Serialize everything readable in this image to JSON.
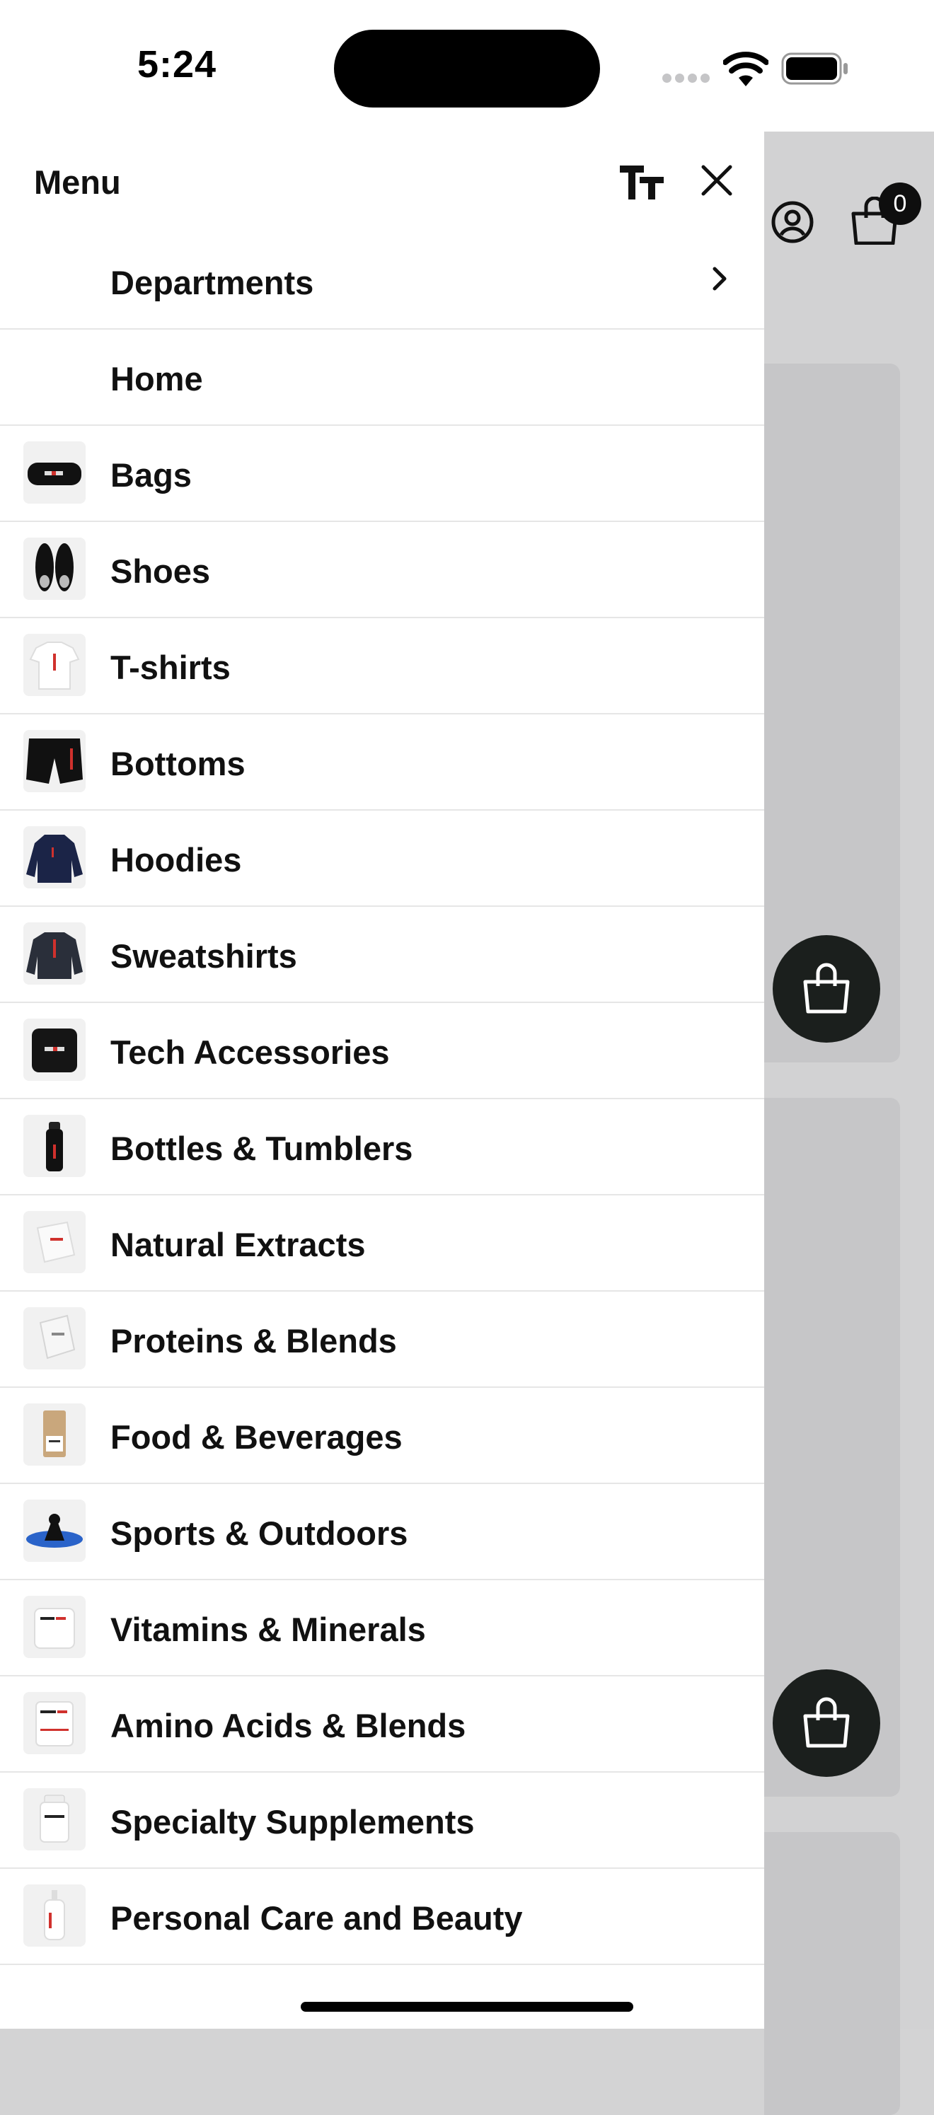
{
  "status_bar": {
    "time": "5:24"
  },
  "drawer": {
    "title": "Menu",
    "text_size_icon": "text-size-icon",
    "close_icon": "close-icon",
    "items": [
      {
        "label": "Departments",
        "has_chevron": true
      },
      {
        "label": "Home"
      },
      {
        "label": "Bags",
        "thumb": "bag"
      },
      {
        "label": "Shoes",
        "thumb": "shoes"
      },
      {
        "label": "T-shirts",
        "thumb": "tshirt"
      },
      {
        "label": "Bottoms",
        "thumb": "shorts"
      },
      {
        "label": "Hoodies",
        "thumb": "hoodie"
      },
      {
        "label": "Sweatshirts",
        "thumb": "sweatshirt"
      },
      {
        "label": "Tech Accessories",
        "thumb": "speaker"
      },
      {
        "label": "Bottles & Tumblers",
        "thumb": "bottle"
      },
      {
        "label": "Natural Extracts",
        "thumb": "pouch"
      },
      {
        "label": "Proteins & Blends",
        "thumb": "tub"
      },
      {
        "label": "Food & Beverages",
        "thumb": "coffee-bag"
      },
      {
        "label": "Sports & Outdoors",
        "thumb": "ab-roller"
      },
      {
        "label": "Vitamins & Minerals",
        "thumb": "jar"
      },
      {
        "label": "Amino Acids & Blends",
        "thumb": "canister"
      },
      {
        "label": "Specialty Supplements",
        "thumb": "pill-bottle"
      },
      {
        "label": "Personal Care and Beauty",
        "thumb": "pump-bottle"
      }
    ]
  },
  "background": {
    "cart_count": "0",
    "icons": [
      "account-icon",
      "shopping-bag-icon"
    ]
  },
  "colors": {
    "drawer_bg": "#ffffff",
    "overlay": "#d3d3d4",
    "fab": "#1b1f1d",
    "accent_red": "#d0312d"
  }
}
